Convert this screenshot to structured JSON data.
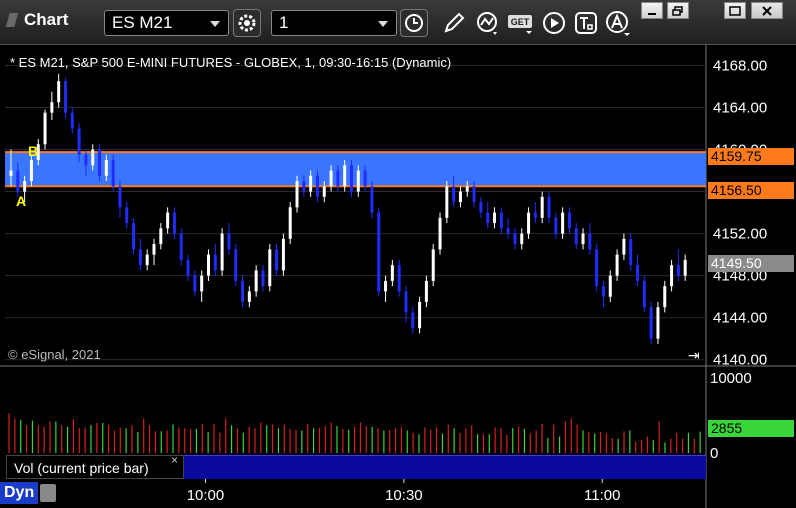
{
  "window": {
    "title": "Chart",
    "symbol": "ES M21",
    "interval": "1"
  },
  "toolbar": {
    "icons": [
      "settings-icon",
      "clock-icon",
      "pencil-icon",
      "study-icon",
      "get-icon",
      "play-icon",
      "text-icon",
      "alert-icon"
    ],
    "get_label": "GET"
  },
  "chart": {
    "label": "* ES M21, S&P 500 E-MINI FUTURES - GLOBEX, 1, 09:30-16:15 (Dynamic)",
    "copyright": "© eSignal, 2021",
    "marker_a": "A",
    "marker_b": "B",
    "band_upper": "4159.75",
    "band_lower": "4156.50",
    "last_price": "4149.50",
    "colors": {
      "up": "#ffffff",
      "down": "#1f2bff",
      "band": "#3a75ff",
      "band_line": "#ff7a1a",
      "vol_up": "#39d639",
      "vol_down": "#d62020"
    }
  },
  "volume": {
    "label": "Vol (current price bar)",
    "close_glyph": "×",
    "current": "2855"
  },
  "footer": {
    "mode": "Dyn"
  },
  "chart_data": {
    "type": "candlestick",
    "price_axis": {
      "ticks": [
        "4168.00",
        "4164.00",
        "4160.00",
        "4156.00",
        "4152.00",
        "4148.00",
        "4144.00",
        "4140.00"
      ],
      "range": [
        4139.5,
        4168.8
      ]
    },
    "volume_axis": {
      "ticks": [
        "10000",
        "0"
      ],
      "range": [
        0,
        10000
      ]
    },
    "time_axis": {
      "ticks": [
        "10:00",
        "10:30",
        "11:00"
      ]
    },
    "bars": [
      [
        4157.5,
        4160.0,
        4156.5,
        4158.0
      ],
      [
        4158.0,
        4158.8,
        4155.5,
        4156.0
      ],
      [
        4156.0,
        4157.5,
        4155.0,
        4157.0
      ],
      [
        4157.0,
        4159.5,
        4156.5,
        4159.0
      ],
      [
        4159.0,
        4161.0,
        4158.5,
        4160.5
      ],
      [
        4160.5,
        4163.8,
        4160.0,
        4163.5
      ],
      [
        4163.5,
        4165.5,
        4162.8,
        4164.5
      ],
      [
        4164.5,
        4167.2,
        4164.0,
        4166.5
      ],
      [
        4166.5,
        4166.8,
        4163.0,
        4163.5
      ],
      [
        4163.5,
        4164.0,
        4161.5,
        4162.0
      ],
      [
        4162.0,
        4162.5,
        4158.8,
        4159.5
      ],
      [
        4159.5,
        4160.0,
        4157.5,
        4158.5
      ],
      [
        4158.5,
        4160.5,
        4158.0,
        4160.0
      ],
      [
        4160.0,
        4160.5,
        4157.0,
        4157.5
      ],
      [
        4157.5,
        4159.5,
        4157.0,
        4159.0
      ],
      [
        4159.0,
        4159.5,
        4156.0,
        4156.5
      ],
      [
        4156.5,
        4157.0,
        4153.5,
        4154.5
      ],
      [
        4154.5,
        4155.0,
        4152.5,
        4153.0
      ],
      [
        4153.0,
        4153.5,
        4150.0,
        4150.5
      ],
      [
        4150.5,
        4151.5,
        4148.5,
        4149.0
      ],
      [
        4149.0,
        4150.5,
        4148.5,
        4150.0
      ],
      [
        4150.0,
        4151.5,
        4149.0,
        4151.0
      ],
      [
        4151.0,
        4153.0,
        4150.5,
        4152.5
      ],
      [
        4152.5,
        4154.5,
        4152.0,
        4154.0
      ],
      [
        4154.0,
        4154.5,
        4151.5,
        4152.0
      ],
      [
        4152.0,
        4152.5,
        4149.0,
        4149.5
      ],
      [
        4149.5,
        4150.0,
        4147.5,
        4148.0
      ],
      [
        4148.0,
        4148.5,
        4146.0,
        4146.5
      ],
      [
        4146.5,
        4148.5,
        4145.5,
        4148.0
      ],
      [
        4148.0,
        4150.5,
        4147.5,
        4150.0
      ],
      [
        4150.0,
        4151.0,
        4148.0,
        4148.5
      ],
      [
        4148.5,
        4152.5,
        4148.0,
        4152.0
      ],
      [
        4152.0,
        4153.0,
        4150.0,
        4150.5
      ],
      [
        4150.5,
        4151.0,
        4147.0,
        4147.5
      ],
      [
        4147.5,
        4148.0,
        4145.0,
        4145.5
      ],
      [
        4145.5,
        4147.0,
        4145.0,
        4146.5
      ],
      [
        4146.5,
        4149.0,
        4146.0,
        4148.5
      ],
      [
        4148.5,
        4149.0,
        4146.5,
        4147.0
      ],
      [
        4147.0,
        4151.0,
        4146.5,
        4150.5
      ],
      [
        4150.5,
        4151.0,
        4148.0,
        4148.5
      ],
      [
        4148.5,
        4152.0,
        4148.0,
        4151.5
      ],
      [
        4151.5,
        4155.0,
        4151.0,
        4154.5
      ],
      [
        4154.5,
        4157.5,
        4154.0,
        4157.0
      ],
      [
        4157.0,
        4157.5,
        4155.5,
        4156.0
      ],
      [
        4156.0,
        4158.0,
        4155.5,
        4157.5
      ],
      [
        4157.5,
        4158.0,
        4155.0,
        4155.5
      ],
      [
        4155.5,
        4157.0,
        4155.0,
        4156.5
      ],
      [
        4156.5,
        4158.5,
        4156.0,
        4158.0
      ],
      [
        4158.0,
        4158.5,
        4156.0,
        4156.5
      ],
      [
        4156.5,
        4159.0,
        4156.0,
        4158.5
      ],
      [
        4158.5,
        4159.0,
        4155.5,
        4156.0
      ],
      [
        4156.0,
        4158.5,
        4155.5,
        4158.0
      ],
      [
        4158.0,
        4158.5,
        4156.0,
        4156.5
      ],
      [
        4156.5,
        4157.0,
        4153.5,
        4154.0
      ],
      [
        4154.0,
        4154.5,
        4146.0,
        4146.5
      ],
      [
        4146.5,
        4148.0,
        4145.5,
        4147.5
      ],
      [
        4147.5,
        4149.5,
        4147.0,
        4149.0
      ],
      [
        4149.0,
        4149.5,
        4146.0,
        4146.5
      ],
      [
        4146.5,
        4147.0,
        4143.5,
        4144.5
      ],
      [
        4144.5,
        4145.0,
        4142.5,
        4143.0
      ],
      [
        4143.0,
        4146.0,
        4142.5,
        4145.5
      ],
      [
        4145.5,
        4148.0,
        4145.0,
        4147.5
      ],
      [
        4147.5,
        4151.0,
        4147.0,
        4150.5
      ],
      [
        4150.5,
        4154.0,
        4150.0,
        4153.5
      ],
      [
        4153.5,
        4157.0,
        4153.0,
        4156.5
      ],
      [
        4156.5,
        4157.5,
        4154.5,
        4155.0
      ],
      [
        4155.0,
        4156.5,
        4154.5,
        4156.0
      ],
      [
        4156.0,
        4157.0,
        4155.5,
        4156.5
      ],
      [
        4156.5,
        4157.0,
        4154.5,
        4155.0
      ],
      [
        4155.0,
        4155.5,
        4153.5,
        4154.0
      ],
      [
        4154.0,
        4155.0,
        4152.5,
        4153.0
      ],
      [
        4153.0,
        4154.5,
        4152.5,
        4154.0
      ],
      [
        4154.0,
        4154.5,
        4152.0,
        4152.5
      ],
      [
        4152.5,
        4153.5,
        4151.5,
        4152.0
      ],
      [
        4152.0,
        4152.5,
        4150.5,
        4151.0
      ],
      [
        4151.0,
        4152.5,
        4150.5,
        4152.0
      ],
      [
        4152.0,
        4154.5,
        4151.5,
        4154.0
      ],
      [
        4154.0,
        4155.0,
        4153.0,
        4153.5
      ],
      [
        4153.5,
        4156.0,
        4153.0,
        4155.5
      ],
      [
        4155.5,
        4156.0,
        4153.0,
        4153.5
      ],
      [
        4153.5,
        4154.0,
        4151.5,
        4152.0
      ],
      [
        4152.0,
        4154.5,
        4151.5,
        4154.0
      ],
      [
        4154.0,
        4154.5,
        4152.0,
        4152.5
      ],
      [
        4152.5,
        4153.0,
        4150.5,
        4151.0
      ],
      [
        4151.0,
        4152.5,
        4150.5,
        4152.0
      ],
      [
        4152.0,
        4153.0,
        4150.0,
        4150.5
      ],
      [
        4150.5,
        4151.0,
        4146.5,
        4147.0
      ],
      [
        4147.0,
        4147.5,
        4145.0,
        4146.0
      ],
      [
        4146.0,
        4148.5,
        4145.5,
        4148.0
      ],
      [
        4148.0,
        4150.5,
        4147.5,
        4150.0
      ],
      [
        4150.0,
        4152.0,
        4149.5,
        4151.5
      ],
      [
        4151.5,
        4152.0,
        4148.5,
        4149.0
      ],
      [
        4149.0,
        4150.0,
        4147.0,
        4147.5
      ],
      [
        4147.5,
        4148.0,
        4144.5,
        4145.0
      ],
      [
        4145.0,
        4145.5,
        4141.5,
        4142.0
      ],
      [
        4142.0,
        4145.5,
        4141.5,
        4145.0
      ],
      [
        4145.0,
        4147.5,
        4144.5,
        4147.0
      ],
      [
        4147.0,
        4149.5,
        4146.5,
        4149.0
      ],
      [
        4149.0,
        4150.5,
        4147.5,
        4148.0
      ],
      [
        4148.0,
        4150.0,
        4147.5,
        4149.5
      ]
    ],
    "volume": [
      5300,
      4600,
      4400,
      3700,
      4300,
      3700,
      3500,
      4200,
      4200,
      3700,
      3500,
      4500,
      3300,
      3400,
      3700,
      4000,
      4000,
      3800,
      3000,
      3400,
      3300,
      3700,
      2800,
      4600,
      3700,
      2900,
      2900,
      3000,
      3800,
      3400,
      3300,
      3200,
      3200,
      3900,
      2800,
      3900,
      2700,
      4600,
      3700,
      3300,
      2700,
      3500,
      3300,
      4100,
      3700,
      3800,
      3300,
      3800,
      3200,
      3100,
      3000,
      3900,
      3300,
      3300,
      3600,
      4100,
      3600,
      3200,
      3100,
      3500,
      4100,
      3600,
      3500,
      3300,
      3000,
      3100,
      3300,
      3400,
      3000,
      2700,
      2500,
      3400,
      3100,
      3400,
      2600,
      3800,
      3300,
      2700,
      3300,
      3700,
      2500,
      2500,
      2500,
      3400,
      3300,
      2400,
      3300,
      3500,
      3200,
      2600,
      3000,
      3900,
      2000,
      3800,
      2200,
      4200,
      4600,
      3800,
      3000,
      2800,
      2600,
      2800,
      2600,
      2000,
      1900,
      2900,
      3000,
      1500,
      1700,
      2200,
      1700,
      4200,
      1400,
      1900,
      2700,
      1900,
      2700,
      1900,
      2855
    ]
  }
}
